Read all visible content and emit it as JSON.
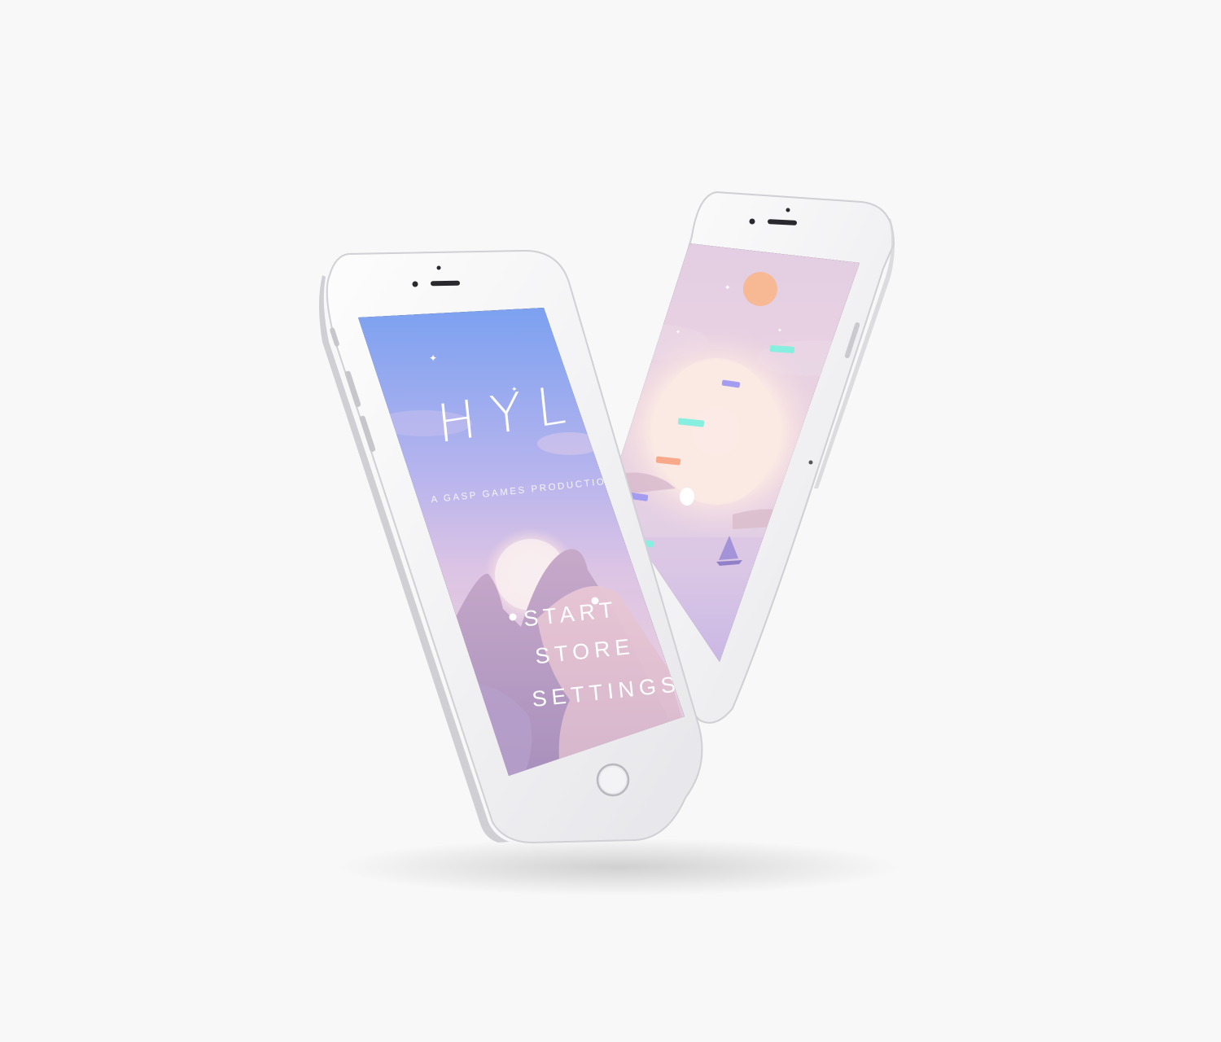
{
  "scene": {
    "background": "#f8f8f8",
    "phone_body_color": "#f4f4f5",
    "phone_frame_color": "#d8d8dc"
  },
  "main_menu_screen": {
    "logo": "HYLO",
    "subtitle": "A GASP GAMES PRODUCTIONS",
    "menu": {
      "start": "START",
      "store": "STORE",
      "settings": "SETTINGS"
    },
    "colors": {
      "sky_top": "#7aa0f0",
      "sky_mid": "#c6b3e6",
      "sky_bottom": "#e8cfe0",
      "mountain": "#b89bbf",
      "sun": "#f6e8ec"
    }
  },
  "gameplay_screen": {
    "colors": {
      "sky_top": "#e6cfe4",
      "sky_bottom": "#c0b0e8",
      "sun": "#fbe6dd",
      "moon": "#f7b894",
      "teal": "#86efe0",
      "lavender": "#a49cf0",
      "coral": "#f7a98a"
    },
    "icons": [
      "sailboat-icon",
      "ball-icon",
      "moon-icon"
    ]
  }
}
